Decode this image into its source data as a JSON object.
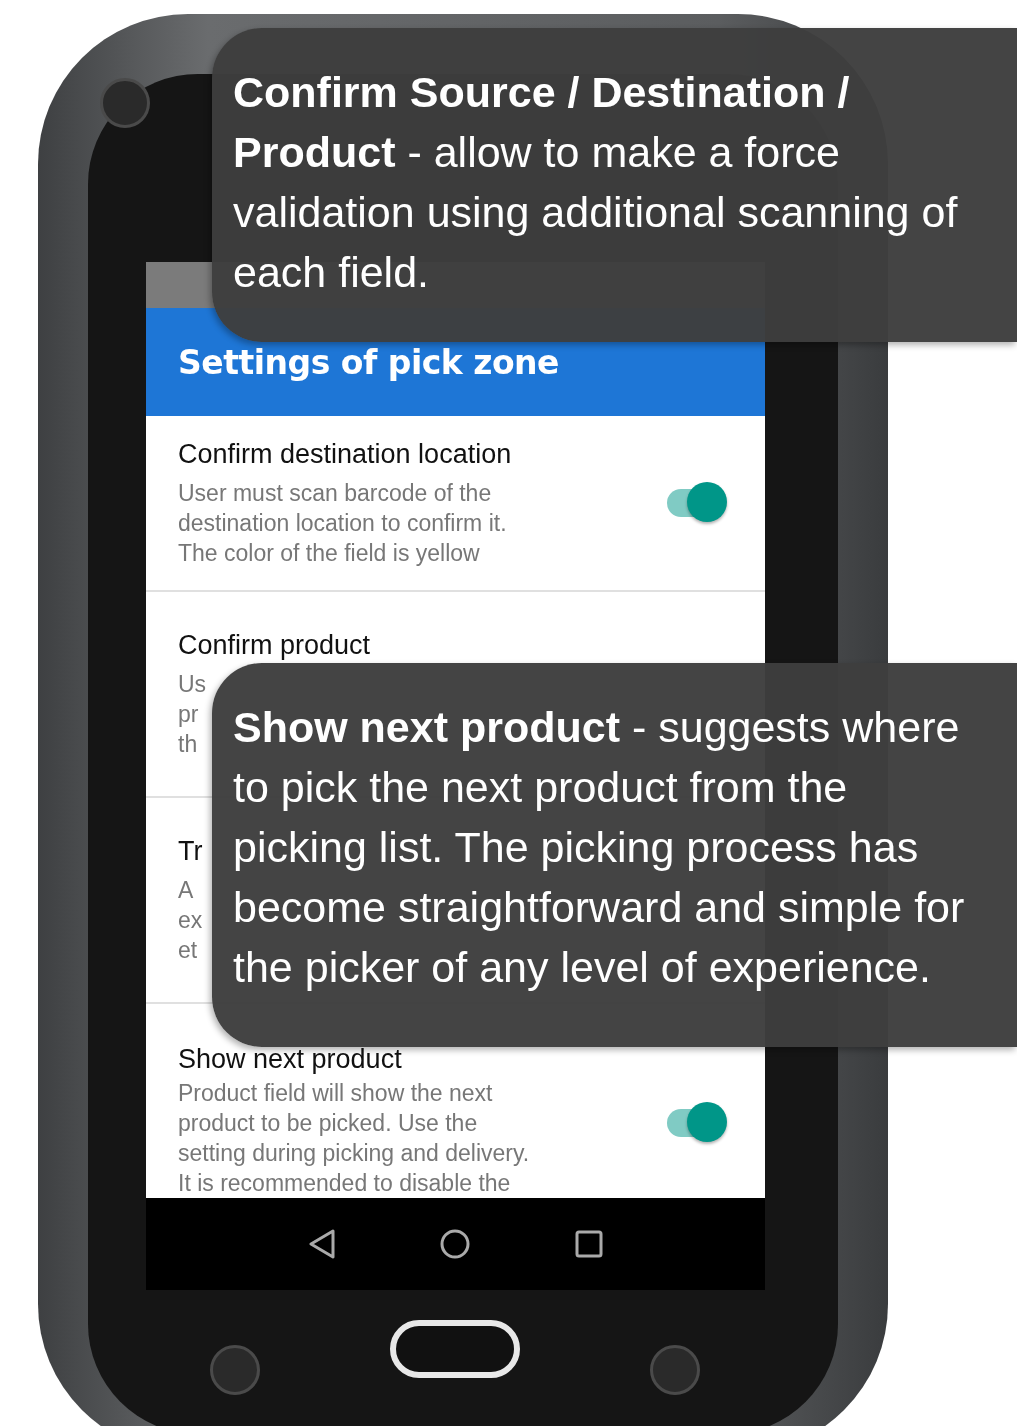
{
  "screen": {
    "title": "Settings of pick zone",
    "settings": [
      {
        "title": "Confirm destination location",
        "description": [
          "User must scan barcode of the",
          "destination location to confirm it.",
          "The color of the field is yellow"
        ],
        "on": true
      },
      {
        "title": "Confirm product",
        "description": [
          "Us",
          "pr",
          "th"
        ]
      },
      {
        "title": "Tr",
        "description": [
          "A",
          "ex",
          "et"
        ]
      },
      {
        "title": "Show next product",
        "description": [
          "Product field will show the next",
          "product to be picked. Use the",
          "setting during picking and delivery.",
          "It is recommended to disable the"
        ],
        "on": true
      }
    ]
  },
  "callouts": [
    {
      "text": "**Confirm Source / Destination / Product** - allow to make a force validation using additional scanning of each field."
    },
    {
      "text": "**Show next product** - suggests where to pick the next product from the picking list. The picking process has become straightforward and simple for the picker of any level of experience."
    }
  ]
}
